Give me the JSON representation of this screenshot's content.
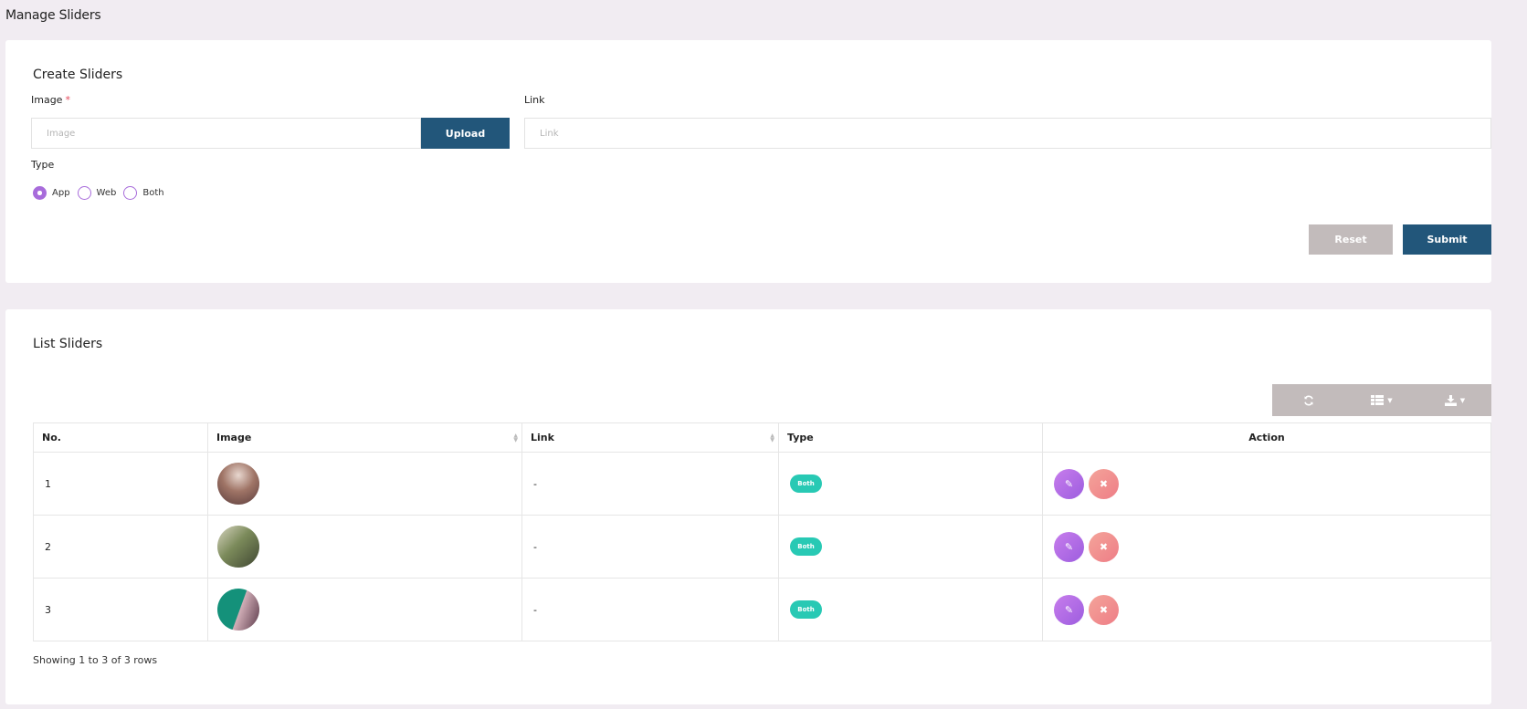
{
  "page": {
    "title": "Manage Sliders"
  },
  "create": {
    "title": "Create Sliders",
    "image_label": "Image",
    "required_mark": "*",
    "image_placeholder": "Image",
    "upload_label": "Upload",
    "link_label": "Link",
    "link_placeholder": "Link",
    "type_label": "Type",
    "type_options": [
      {
        "label": "App",
        "checked": true
      },
      {
        "label": "Web",
        "checked": false
      },
      {
        "label": "Both",
        "checked": false
      }
    ],
    "reset_label": "Reset",
    "submit_label": "Submit"
  },
  "list": {
    "title": "List Sliders",
    "toolbar": [
      {
        "icon": "refresh-icon"
      },
      {
        "icon": "columns-icon"
      },
      {
        "icon": "download-icon"
      }
    ],
    "columns": [
      "No.",
      "Image",
      "Link",
      "Type",
      "Action"
    ],
    "rows": [
      {
        "no": "1",
        "link": "-",
        "type": "Both"
      },
      {
        "no": "2",
        "link": "-",
        "type": "Both"
      },
      {
        "no": "3",
        "link": "-",
        "type": "Both"
      }
    ],
    "footer": "Showing 1 to 3 of 3 rows"
  },
  "colors": {
    "primary": "#22567a",
    "reset": "#c2bbbb",
    "radio": "#a86cdb",
    "badge": "#28c9b4",
    "edit": "#b06de5",
    "delete": "#f08a8c",
    "background": "#f1ecf2"
  }
}
